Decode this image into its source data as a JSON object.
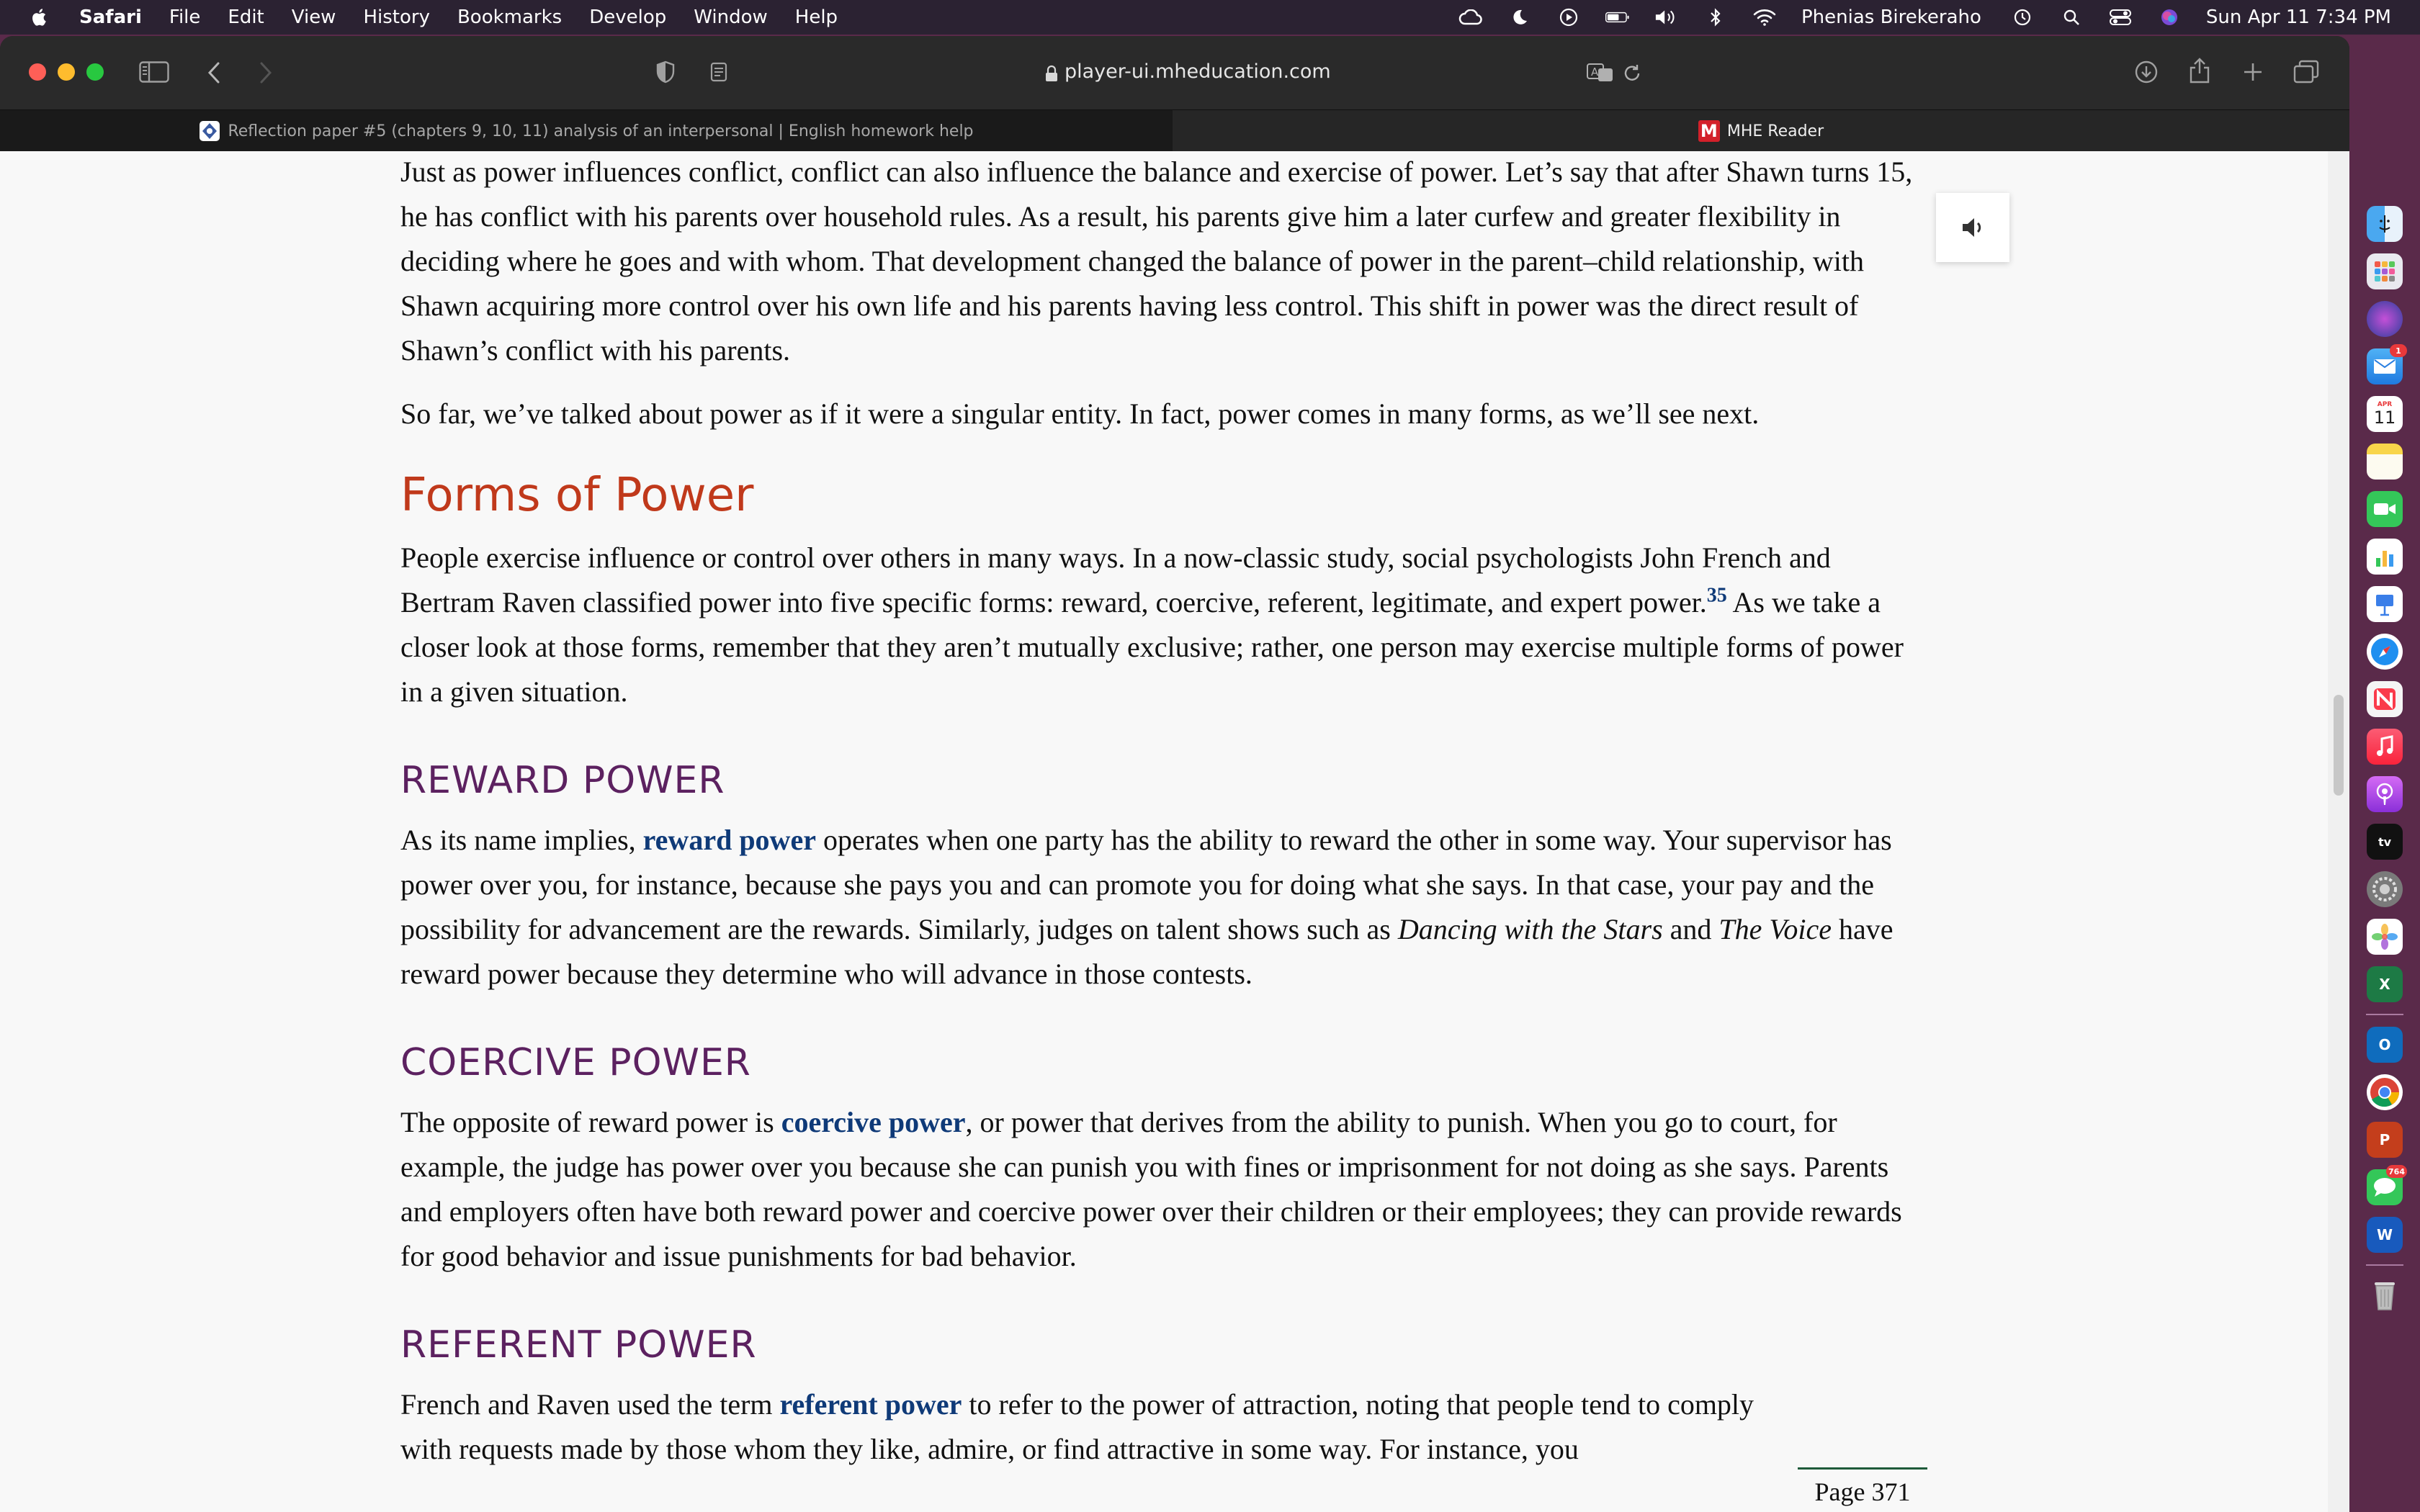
{
  "menubar": {
    "app_name": "Safari",
    "items": [
      "File",
      "Edit",
      "View",
      "History",
      "Bookmarks",
      "Develop",
      "Window",
      "Help"
    ],
    "user_name": "Phenias Birekeraho",
    "datetime": "Sun Apr 11  7:34 PM"
  },
  "browser": {
    "url": "player-ui.mheducation.com",
    "tabs": [
      {
        "title": "Reflection paper #5 (chapters 9, 10, 11) analysis of an interpersonal | English homework help",
        "active": false
      },
      {
        "title": "MHE Reader",
        "icon_letter": "M",
        "active": true
      }
    ]
  },
  "article": {
    "p1": "Just as power influences conflict, conflict can also influence the balance and exercise of power. Let’s say that after Shawn turns 15, he has conflict with his parents over household rules. As a result, his parents give him a later curfew and greater flexibility in deciding where he goes and with whom. That development changed the balance of power in the parent–child relationship, with Shawn acquiring more control over his own life and his parents having less control. This shift in power was the direct result of Shawn’s conflict with his parents.",
    "p2": "So far, we’ve talked about power as if it were a singular entity. In fact, power comes in many forms, as we’ll see next.",
    "h_forms": "Forms of Power",
    "p3_a": "People exercise influence or control over others in many ways. In a now-classic study, social psychologists John French and Bertram Raven classified power into five specific forms: reward, coercive, referent, legitimate, and expert power.",
    "p3_fn": "35",
    "p3_b": " As we take a closer look at those forms, remember that they aren’t mutually exclusive; rather, one person may exercise multiple forms of power in a given situation.",
    "h_reward": "REWARD POWER",
    "p4_a": "As its name implies, ",
    "p4_term": "reward power",
    "p4_b": " operates when one party has the ability to reward the other in some way. Your supervisor has power over you, for instance, because she pays you and can promote you for doing what she says. In that case, your pay and the possibility for advancement are the rewards. Similarly, judges on talent shows such as ",
    "p4_show1": "Dancing with the Stars",
    "p4_c": " and ",
    "p4_show2": "The Voice",
    "p4_d": " have reward power because they determine who will advance in those contests.",
    "h_coercive": "COERCIVE POWER",
    "p5_a": "The opposite of reward power is ",
    "p5_term": "coercive power",
    "p5_b": ", or power that derives from the ability to punish. When you go to court, for example, the judge has power over you because she can punish you with fines or imprisonment for not doing as she says. Parents and employers often have both reward power and coercive power over their children or their employees; they can provide rewards for good behavior and issue punishments for bad behavior.",
    "h_referent": "REFERENT POWER",
    "p6_a": "French and Raven used the term ",
    "p6_term": "referent power",
    "p6_b": " to refer to the power of attraction, noting that people tend to comply with requests made by those whom they like, admire, or find attractive in some way. For instance, you",
    "page_marker": "Page 371"
  },
  "dock": {
    "calendar_month": "APR",
    "calendar_day": "11",
    "mail_badge": "1",
    "messages_badge": "764",
    "tv_label": "tv",
    "excel_letter": "X",
    "outlook_letter": "O",
    "powerpoint_letter": "P",
    "word_letter": "W"
  },
  "colors": {
    "heading_orange": "#c0391b",
    "heading_purple": "#5c2160",
    "term_blue": "#0f3a78"
  }
}
